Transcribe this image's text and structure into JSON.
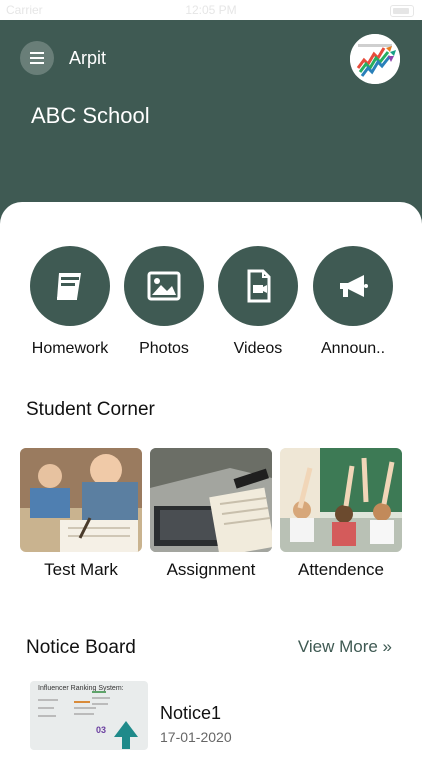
{
  "status_bar": {
    "carrier": "Carrier",
    "time": "12:05 PM"
  },
  "header": {
    "user_name": "Arpit",
    "school_name": "ABC School",
    "colors": {
      "primary": "#3f5a53"
    }
  },
  "quick_actions": [
    {
      "label": "Homework",
      "icon": "book-icon"
    },
    {
      "label": "Photos",
      "icon": "image-icon"
    },
    {
      "label": "Videos",
      "icon": "video-file-icon"
    },
    {
      "label": "Announ..",
      "icon": "megaphone-icon"
    }
  ],
  "student_corner": {
    "title": "Student Corner",
    "items": [
      {
        "label": "Test Mark"
      },
      {
        "label": "Assignment"
      },
      {
        "label": "Attendence"
      }
    ]
  },
  "notice_board": {
    "title": "Notice Board",
    "view_more": "View More »",
    "notices": [
      {
        "title": "Notice1",
        "date": "17-01-2020",
        "thumb_text": "Influencer Ranking System:",
        "badge": "03"
      }
    ]
  }
}
